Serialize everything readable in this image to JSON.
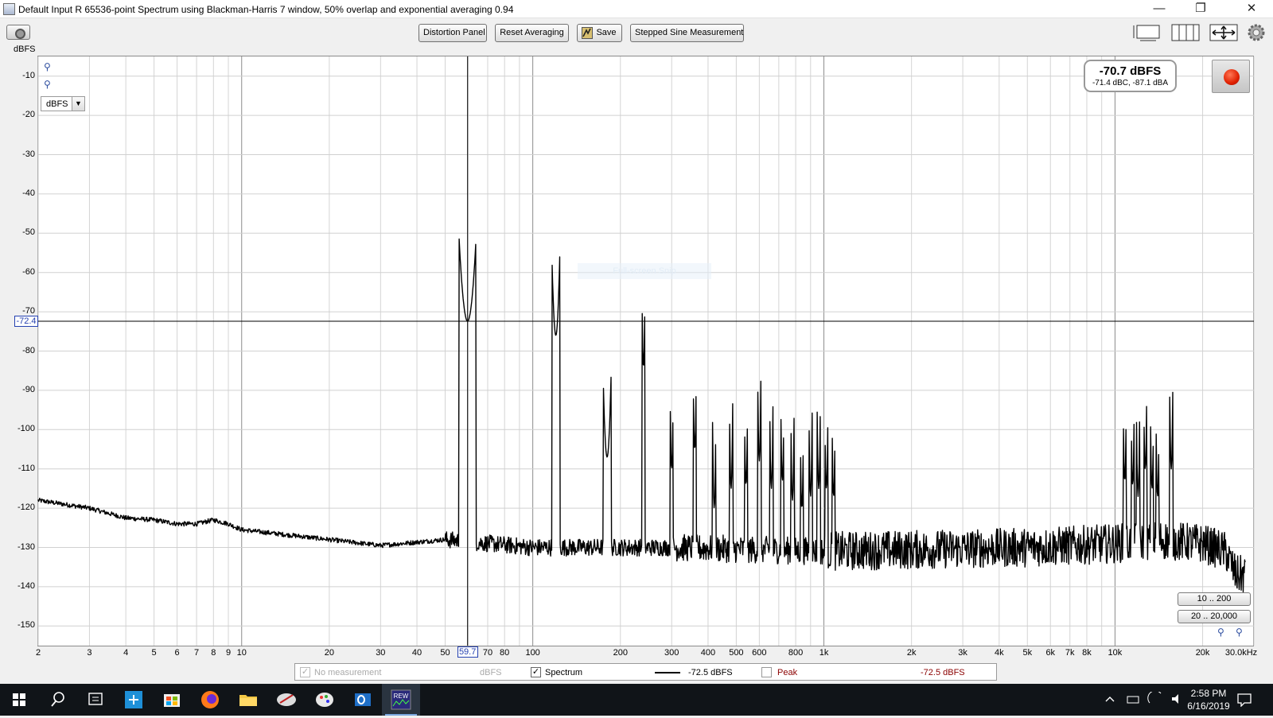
{
  "window": {
    "title": "Default Input R 65536-point Spectrum using Blackman-Harris 7 window, 50% overlap and exponential averaging 0.94",
    "minimize": "—",
    "restore": "❐",
    "close": "✕"
  },
  "toolbar": {
    "unit_label": "dBFS",
    "distortion_panel": "Distortion Panel",
    "reset_averaging": "Reset Averaging",
    "save": "Save",
    "stepped_sine": "Stepped Sine Measurement"
  },
  "plot": {
    "unit_select": "dBFS",
    "readout_main": "-70.7 dBFS",
    "readout_sub": "-71.4 dBC, -87.1 dBA",
    "cursor_y_label": "-72.4",
    "cursor_x_label": "59.7",
    "range_low": "10 .. 200",
    "range_high": "20 .. 20,000",
    "watermark": "Full-screen Snip"
  },
  "legend": {
    "no_measurement": "No measurement",
    "no_measurement_unit": "dBFS",
    "spectrum": "Spectrum",
    "spectrum_value": "-72.5 dBFS",
    "peak": "Peak",
    "peak_value": "-72.5 dBFS",
    "spectrum_color": "#000000",
    "peak_color": "#8b0000"
  },
  "taskbar": {
    "time": "2:58 PM",
    "date": "6/16/2019"
  },
  "chart_data": {
    "type": "line",
    "xscale": "log",
    "xlim": [
      2,
      30000
    ],
    "ylim": [
      -155,
      -5
    ],
    "ylabel": "dBFS",
    "x_ticks": [
      "2",
      "3",
      "4",
      "5",
      "6",
      "7",
      "8",
      "9",
      "10",
      "20",
      "30",
      "40",
      "50",
      "70",
      "80",
      "100",
      "200",
      "300",
      "400",
      "500",
      "600",
      "800",
      "1k",
      "2k",
      "3k",
      "4k",
      "5k",
      "6k",
      "7k",
      "8k",
      "10k",
      "20k",
      "30.0kHz"
    ],
    "y_ticks": [
      "-10",
      "-20",
      "-30",
      "-40",
      "-50",
      "-60",
      "-70",
      "-80",
      "-90",
      "-100",
      "-110",
      "-120",
      "-130",
      "-140",
      "-150"
    ],
    "cursor": {
      "x": 59.7,
      "y": -72.4
    },
    "series": [
      {
        "name": "Spectrum",
        "noise_floor": [
          [
            2,
            -118
          ],
          [
            3,
            -120
          ],
          [
            4,
            -122.5
          ],
          [
            5,
            -123
          ],
          [
            6,
            -124
          ],
          [
            7,
            -124
          ],
          [
            8,
            -123
          ],
          [
            9,
            -124
          ],
          [
            10,
            -125.5
          ],
          [
            20,
            -128
          ],
          [
            30,
            -129.5
          ],
          [
            50,
            -128
          ],
          [
            100,
            -130
          ],
          [
            300,
            -130
          ],
          [
            1000,
            -131
          ],
          [
            5000,
            -130
          ],
          [
            10000,
            -129
          ],
          [
            14000,
            -128
          ],
          [
            20000,
            -129
          ],
          [
            24000,
            -131
          ],
          [
            26000,
            -137
          ],
          [
            28000,
            -137
          ]
        ],
        "peaks": [
          [
            59.7,
            -72.4
          ],
          [
            120,
            -76
          ],
          [
            180,
            -107
          ],
          [
            240,
            -84
          ],
          [
            300,
            -110
          ],
          [
            360,
            -105
          ],
          [
            420,
            -120
          ],
          [
            480,
            -115
          ],
          [
            540,
            -114
          ],
          [
            600,
            -108
          ],
          [
            660,
            -115
          ],
          [
            720,
            -113
          ],
          [
            780,
            -118
          ],
          [
            840,
            -120
          ],
          [
            900,
            -117
          ],
          [
            960,
            -115
          ],
          [
            1020,
            -115
          ],
          [
            1080,
            -117
          ],
          [
            10800,
            -113
          ],
          [
            11500,
            -114
          ],
          [
            12000,
            -117
          ],
          [
            12700,
            -110
          ],
          [
            13400,
            -115
          ],
          [
            14000,
            -117
          ],
          [
            15600,
            -110
          ]
        ]
      }
    ]
  }
}
